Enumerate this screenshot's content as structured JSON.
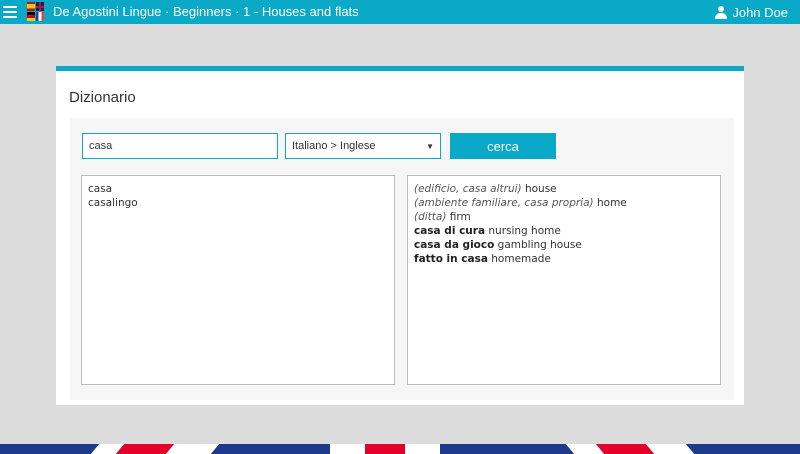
{
  "header": {
    "title": "De Agostini Lingue · Beginners · 1 - Houses and flats",
    "user_name": "John Doe",
    "menu_icon": "hamburger-icon",
    "flags_icon": "language-flags-icon",
    "user_icon": "user-icon"
  },
  "dictionary": {
    "title": "Dizionario",
    "search_value": "casa",
    "language_pair": "Italiano > Inglese",
    "search_button": "cerca",
    "suggestions": [
      "casa",
      "casalingo"
    ],
    "translations": [
      {
        "context": "(edificio, casa altrui)",
        "term": "",
        "translation": "house"
      },
      {
        "context": "(ambiente familiare, casa propria)",
        "term": "",
        "translation": "home"
      },
      {
        "context": "(ditta)",
        "term": "",
        "translation": "firm"
      },
      {
        "context": "",
        "term": "casa di cura",
        "translation": "nursing home"
      },
      {
        "context": "",
        "term": "casa da gioco",
        "translation": "gambling house"
      },
      {
        "context": "",
        "term": "fatto in casa",
        "translation": "homemade"
      }
    ]
  },
  "colors": {
    "accent": "#0aa9c8",
    "background": "#dcdcdc"
  }
}
